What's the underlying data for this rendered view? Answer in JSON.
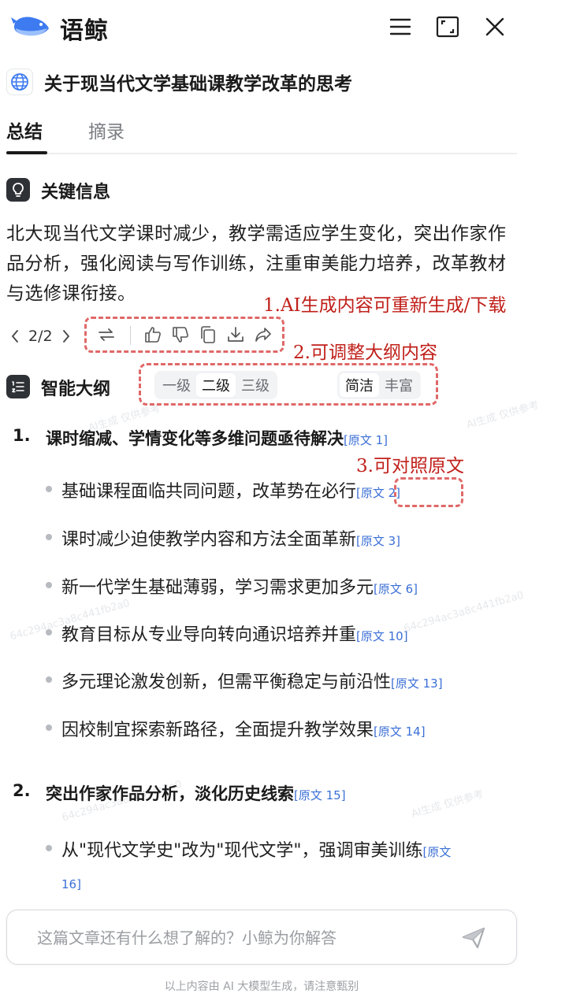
{
  "app": {
    "name": "语鲸"
  },
  "document": {
    "title": "关于现当代文学基础课教学改革的思考"
  },
  "tabs": [
    {
      "label": "总结",
      "active": true
    },
    {
      "label": "摘录",
      "active": false
    }
  ],
  "key_info": {
    "title": "关键信息",
    "text": "北大现当代文学课时减少，教学需适应学生变化，突出作家作品分析，强化阅读与写作训练，注重审美能力培养，改革教材与选修课衔接。"
  },
  "pager": {
    "label": "2/2"
  },
  "annotations": {
    "a1": "1.AI生成内容可重新生成/下载",
    "a2": "2.可调整大纲内容",
    "a3": "3.可对照原文"
  },
  "outline": {
    "title": "智能大纲",
    "levels": [
      "一级",
      "二级",
      "三级"
    ],
    "selected_level": "二级",
    "styles": [
      "简洁",
      "丰富"
    ],
    "selected_style": "简洁",
    "sections": [
      {
        "num": "1.",
        "text": "课时缩减、学情变化等多维问题亟待解决",
        "ref": "[原文 1]",
        "items": [
          {
            "text": "基础课程面临共同问题，改革势在必行",
            "ref": "[原文 2]"
          },
          {
            "text": "课时减少迫使教学内容和方法全面革新",
            "ref": "[原文 3]"
          },
          {
            "text": "新一代学生基础薄弱，学习需求更加多元",
            "ref": "[原文 6]"
          },
          {
            "text": "教育目标从专业导向转向通识培养并重",
            "ref": "[原文 10]"
          },
          {
            "text": "多元理论激发创新，但需平衡稳定与前沿性",
            "ref": "[原文 13]"
          },
          {
            "text": "因校制宜探索新路径，全面提升教学效果",
            "ref": "[原文 14]"
          }
        ]
      },
      {
        "num": "2.",
        "text": "突出作家作品分析，淡化历史线索",
        "ref": "[原文 15]",
        "items": [
          {
            "text": "从\"现代文学史\"改为\"现代文学\"，强调审美训练",
            "ref": "[原文",
            "ref_cont": "16]"
          }
        ]
      }
    ]
  },
  "chat": {
    "placeholder": "这篇文章还有什么想了解的？小鲸为你解答"
  },
  "footer": {
    "text": "以上内容由 AI 大模型生成，请注意甄别"
  },
  "colors": {
    "annotation": "#c0201a",
    "dashed_box": "#e06868",
    "ref_link": "#3b6fd6",
    "icon_dark": "#2e3135",
    "logo_blue": "#3e7bf0"
  },
  "watermark": {
    "ai_text": "AI生成 仅供参考",
    "id_fragment": "64c294ac3a8c441fb2a0"
  }
}
